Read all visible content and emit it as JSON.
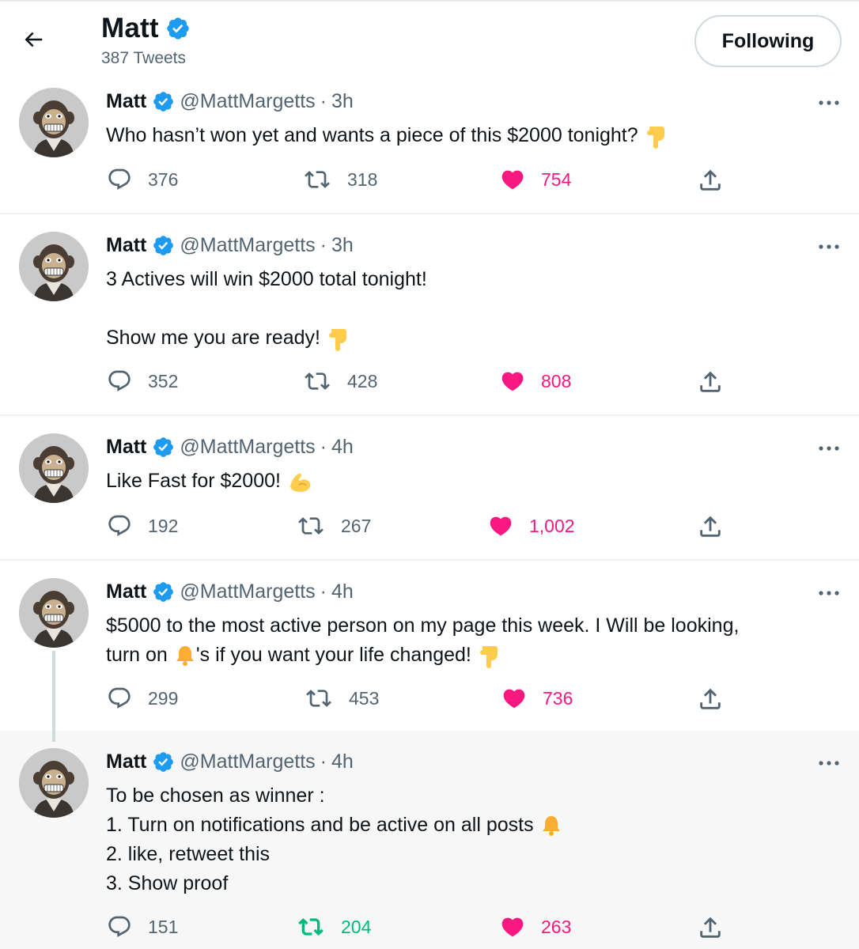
{
  "header": {
    "back_icon": "arrow-left-icon",
    "name": "Matt",
    "tweet_count": "387 Tweets",
    "following_label": "Following"
  },
  "colors": {
    "verified": "#1d9bf0",
    "like": "#f91880",
    "retweet_active": "#00ba7c",
    "secondary_text": "#536471"
  },
  "tweets": [
    {
      "name": "Matt",
      "handle": "@MattMargetts",
      "dot": "·",
      "time": "3h",
      "lines": [
        "Who hasn’t won yet and wants a piece of this $2000 tonight?"
      ],
      "emoji": "pointing-down-icon",
      "replies": "376",
      "retweets": "318",
      "likes": "754"
    },
    {
      "name": "Matt",
      "handle": "@MattMargetts",
      "dot": "·",
      "time": "3h",
      "line1": "3 Actives will win $2000 total tonight!",
      "line2": "Show me you are ready!",
      "emoji": "pointing-down-icon",
      "replies": "352",
      "retweets": "428",
      "likes": "808"
    },
    {
      "name": "Matt",
      "handle": "@MattMargetts",
      "dot": "·",
      "time": "4h",
      "line1": "Like Fast for $2000!",
      "emoji": "flexed-bicep-icon",
      "replies": "192",
      "retweets": "267",
      "likes": "1,002"
    },
    {
      "name": "Matt",
      "handle": "@MattMargetts",
      "dot": "·",
      "time": "4h",
      "line1": "$5000 to the most active person on my page this week. I Will be looking,",
      "line2a": "turn on",
      "line2b": "'s if you want your life changed!",
      "emoji_bell": "bell-icon",
      "emoji": "pointing-down-icon",
      "replies": "299",
      "retweets": "453",
      "likes": "736"
    },
    {
      "name": "Matt",
      "handle": "@MattMargetts",
      "dot": "·",
      "time": "4h",
      "line1": "To be chosen as winner :",
      "line2": "1. Turn on notifications and be active on all posts",
      "line3": "2. like, retweet this",
      "line4": "3. Show proof",
      "emoji_bell": "bell-icon",
      "replies": "151",
      "retweets": "204",
      "likes": "263",
      "retweeted": true
    }
  ]
}
